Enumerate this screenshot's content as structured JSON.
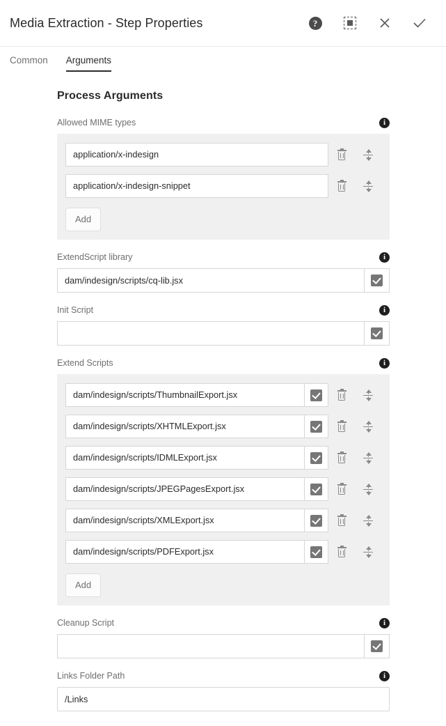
{
  "header": {
    "title": "Media Extraction - Step Properties",
    "actions": [
      {
        "name": "help-icon",
        "glyph": "?"
      },
      {
        "name": "fullscreen-icon",
        "glyph": ""
      },
      {
        "name": "close-icon",
        "glyph": "✕"
      },
      {
        "name": "confirm-icon",
        "glyph": "✓"
      }
    ]
  },
  "tabs": [
    {
      "label": "Common",
      "active": false
    },
    {
      "label": "Arguments",
      "active": true
    }
  ],
  "main": {
    "section_title": "Process Arguments",
    "info_glyph": "i",
    "add_label": "Add",
    "fields": [
      {
        "label": "Allowed MIME types",
        "type": "multi",
        "has_checkbox": false,
        "values": [
          "application/x-indesign",
          "application/x-indesign-snippet"
        ]
      },
      {
        "label": "ExtendScript library",
        "type": "single",
        "has_checkbox": true,
        "checked": true,
        "value": "dam/indesign/scripts/cq-lib.jsx"
      },
      {
        "label": "Init Script",
        "type": "single",
        "has_checkbox": true,
        "checked": true,
        "value": ""
      },
      {
        "label": "Extend Scripts",
        "type": "multi",
        "has_checkbox": true,
        "values": [
          "dam/indesign/scripts/ThumbnailExport.jsx",
          "dam/indesign/scripts/XHTMLExport.jsx",
          "dam/indesign/scripts/IDMLExport.jsx",
          "dam/indesign/scripts/JPEGPagesExport.jsx",
          "dam/indesign/scripts/XMLExport.jsx",
          "dam/indesign/scripts/PDFExport.jsx"
        ],
        "checked": [
          true,
          true,
          true,
          true,
          true,
          true
        ]
      },
      {
        "label": "Cleanup Script",
        "type": "single",
        "has_checkbox": true,
        "checked": true,
        "value": ""
      },
      {
        "label": "Links Folder Path",
        "type": "single",
        "has_checkbox": false,
        "value": "/Links"
      }
    ]
  },
  "colors": {
    "panel_bg": "#f0f0f0",
    "border": "#d6d6d6",
    "label": "#6e6e6e",
    "text": "#2b2b2b",
    "checkbox_fill": "#767676",
    "icon_gray": "#8a8a8a"
  }
}
